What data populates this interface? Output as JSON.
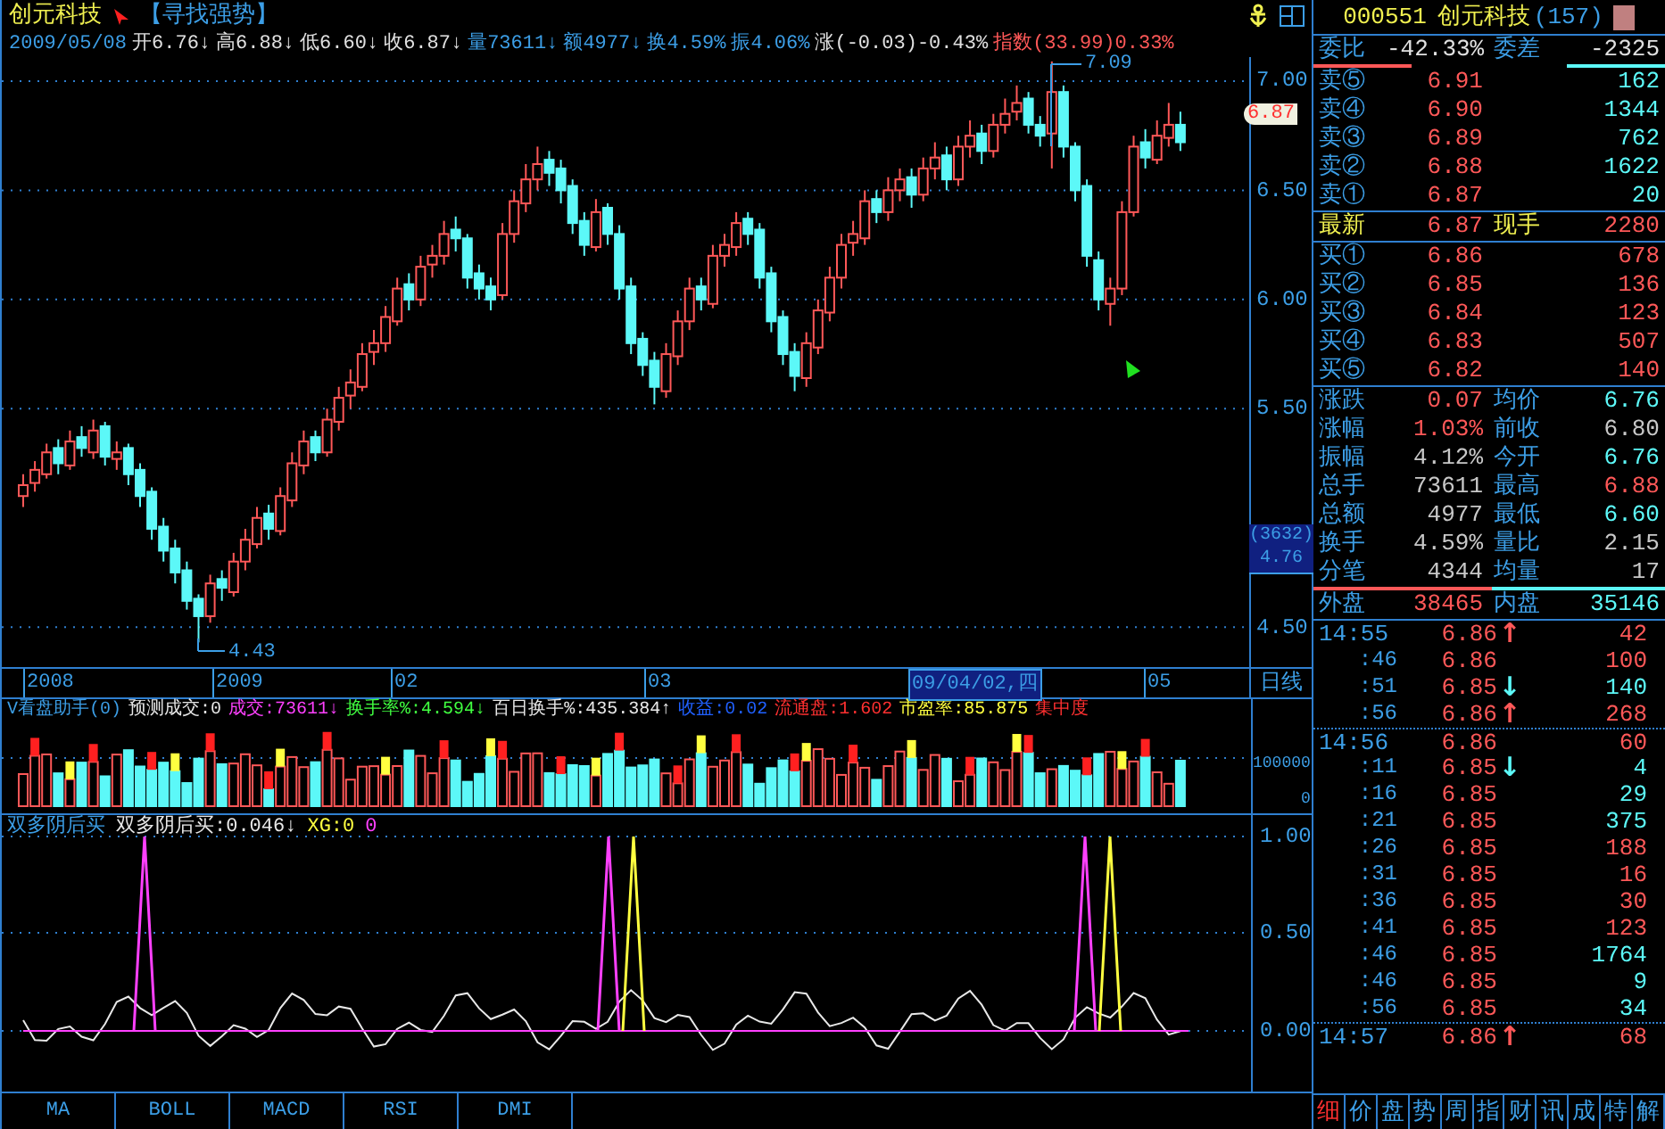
{
  "header": {
    "title": "创元科技",
    "tag": "【寻找强势】"
  },
  "info_line": [
    {
      "text": "2009/05/08",
      "color": "#3c9ee6"
    },
    {
      "text": "开6.76↓",
      "color": "#e0e0e0"
    },
    {
      "text": "高6.88↓",
      "color": "#e0e0e0"
    },
    {
      "text": "低6.60↓",
      "color": "#e0e0e0"
    },
    {
      "text": "收6.87↓",
      "color": "#e0e0e0"
    },
    {
      "text": "量73611↓",
      "color": "#3c9ee6"
    },
    {
      "text": "额4977↓",
      "color": "#3c9ee6"
    },
    {
      "text": "换4.59%",
      "color": "#3c9ee6"
    },
    {
      "text": "振4.06%",
      "color": "#3c9ee6"
    },
    {
      "text": "涨(-0.03)-0.43%",
      "color": "#e0e0e0"
    },
    {
      "text": "指数(33.99)0.33%",
      "color": "#ff5858"
    }
  ],
  "price_chart": {
    "high_label": "7.09",
    "low_label": "4.43",
    "last_price_tag": "6.87",
    "scale_box": {
      "count": "(3632)",
      "value": "4.76"
    },
    "chart_data": {
      "type": "candlestick",
      "ylim": [
        4.17,
        7.11
      ],
      "grid": true,
      "yticks": [
        {
          "value": 7,
          "label": "7.00"
        },
        {
          "value": 6.5,
          "label": "6.50"
        },
        {
          "value": 6,
          "label": "6.00"
        },
        {
          "value": 5.5,
          "label": "5.50"
        },
        {
          "value": 4.5,
          "label": "4.50"
        }
      ],
      "ohlc": [
        [
          5.1,
          5.2,
          5.05,
          5.15
        ],
        [
          5.16,
          5.26,
          5.12,
          5.22
        ],
        [
          5.2,
          5.34,
          5.18,
          5.3
        ],
        [
          5.32,
          5.36,
          5.2,
          5.25
        ],
        [
          5.24,
          5.4,
          5.22,
          5.35
        ],
        [
          5.37,
          5.42,
          5.28,
          5.32
        ],
        [
          5.3,
          5.45,
          5.27,
          5.4
        ],
        [
          5.42,
          5.44,
          5.24,
          5.28
        ],
        [
          5.27,
          5.35,
          5.22,
          5.3
        ],
        [
          5.32,
          5.34,
          5.15,
          5.2
        ],
        [
          5.22,
          5.25,
          5.05,
          5.1
        ],
        [
          5.12,
          5.14,
          4.9,
          4.95
        ],
        [
          4.96,
          5.0,
          4.8,
          4.85
        ],
        [
          4.86,
          4.9,
          4.7,
          4.75
        ],
        [
          4.76,
          4.8,
          4.58,
          4.62
        ],
        [
          4.63,
          4.65,
          4.43,
          4.55
        ],
        [
          4.55,
          4.74,
          4.52,
          4.7
        ],
        [
          4.72,
          4.76,
          4.62,
          4.68
        ],
        [
          4.66,
          4.84,
          4.64,
          4.8
        ],
        [
          4.8,
          4.95,
          4.76,
          4.9
        ],
        [
          4.88,
          5.05,
          4.86,
          5.0
        ],
        [
          5.02,
          5.06,
          4.9,
          4.95
        ],
        [
          4.94,
          5.14,
          4.92,
          5.1
        ],
        [
          5.08,
          5.3,
          5.05,
          5.25
        ],
        [
          5.24,
          5.4,
          5.2,
          5.35
        ],
        [
          5.37,
          5.4,
          5.26,
          5.3
        ],
        [
          5.3,
          5.5,
          5.28,
          5.45
        ],
        [
          5.44,
          5.6,
          5.4,
          5.55
        ],
        [
          5.56,
          5.68,
          5.5,
          5.62
        ],
        [
          5.6,
          5.8,
          5.58,
          5.75
        ],
        [
          5.76,
          5.86,
          5.7,
          5.8
        ],
        [
          5.8,
          5.97,
          5.76,
          5.92
        ],
        [
          5.9,
          6.1,
          5.88,
          6.05
        ],
        [
          6.07,
          6.12,
          5.95,
          6.0
        ],
        [
          6.0,
          6.2,
          5.97,
          6.15
        ],
        [
          6.16,
          6.25,
          6.1,
          6.2
        ],
        [
          6.2,
          6.36,
          6.16,
          6.3
        ],
        [
          6.32,
          6.38,
          6.22,
          6.28
        ],
        [
          6.28,
          6.3,
          6.05,
          6.1
        ],
        [
          6.12,
          6.16,
          6.0,
          6.05
        ],
        [
          6.06,
          6.1,
          5.95,
          6.0
        ],
        [
          6.02,
          6.35,
          6.0,
          6.3
        ],
        [
          6.3,
          6.5,
          6.26,
          6.45
        ],
        [
          6.44,
          6.62,
          6.4,
          6.55
        ],
        [
          6.55,
          6.7,
          6.5,
          6.62
        ],
        [
          6.64,
          6.68,
          6.52,
          6.58
        ],
        [
          6.6,
          6.64,
          6.44,
          6.5
        ],
        [
          6.52,
          6.55,
          6.3,
          6.35
        ],
        [
          6.36,
          6.4,
          6.2,
          6.25
        ],
        [
          6.24,
          6.46,
          6.22,
          6.4
        ],
        [
          6.42,
          6.44,
          6.25,
          6.3
        ],
        [
          6.3,
          6.34,
          6.0,
          6.05
        ],
        [
          6.06,
          6.1,
          5.75,
          5.8
        ],
        [
          5.82,
          5.85,
          5.65,
          5.7
        ],
        [
          5.72,
          5.76,
          5.52,
          5.6
        ],
        [
          5.58,
          5.8,
          5.55,
          5.75
        ],
        [
          5.74,
          5.95,
          5.7,
          5.9
        ],
        [
          5.9,
          6.1,
          5.86,
          6.05
        ],
        [
          6.06,
          6.1,
          5.95,
          6.0
        ],
        [
          5.98,
          6.25,
          5.96,
          6.2
        ],
        [
          6.2,
          6.3,
          6.15,
          6.25
        ],
        [
          6.24,
          6.4,
          6.2,
          6.35
        ],
        [
          6.37,
          6.4,
          6.25,
          6.3
        ],
        [
          6.32,
          6.35,
          6.05,
          6.1
        ],
        [
          6.12,
          6.15,
          5.85,
          5.9
        ],
        [
          5.92,
          5.95,
          5.7,
          5.75
        ],
        [
          5.76,
          5.8,
          5.58,
          5.65
        ],
        [
          5.64,
          5.85,
          5.6,
          5.8
        ],
        [
          5.78,
          6.0,
          5.75,
          5.95
        ],
        [
          5.94,
          6.15,
          5.9,
          6.1
        ],
        [
          6.1,
          6.3,
          6.05,
          6.25
        ],
        [
          6.26,
          6.36,
          6.2,
          6.3
        ],
        [
          6.28,
          6.5,
          6.25,
          6.45
        ],
        [
          6.46,
          6.5,
          6.35,
          6.4
        ],
        [
          6.4,
          6.56,
          6.36,
          6.5
        ],
        [
          6.5,
          6.6,
          6.45,
          6.55
        ],
        [
          6.56,
          6.6,
          6.42,
          6.48
        ],
        [
          6.48,
          6.65,
          6.45,
          6.6
        ],
        [
          6.6,
          6.72,
          6.55,
          6.65
        ],
        [
          6.66,
          6.7,
          6.5,
          6.55
        ],
        [
          6.55,
          6.75,
          6.52,
          6.7
        ],
        [
          6.7,
          6.82,
          6.65,
          6.75
        ],
        [
          6.76,
          6.8,
          6.62,
          6.68
        ],
        [
          6.68,
          6.85,
          6.65,
          6.8
        ],
        [
          6.8,
          6.92,
          6.76,
          6.85
        ],
        [
          6.86,
          6.98,
          6.82,
          6.9
        ],
        [
          6.92,
          6.95,
          6.76,
          6.8
        ],
        [
          6.8,
          6.84,
          6.7,
          6.75
        ],
        [
          6.76,
          7.09,
          6.6,
          6.95
        ],
        [
          6.95,
          6.98,
          6.65,
          6.7
        ],
        [
          6.7,
          6.72,
          6.45,
          6.5
        ],
        [
          6.52,
          6.55,
          6.15,
          6.2
        ],
        [
          6.18,
          6.22,
          5.95,
          6.0
        ],
        [
          5.98,
          6.1,
          5.88,
          6.05
        ],
        [
          6.05,
          6.45,
          6.02,
          6.4
        ],
        [
          6.4,
          6.75,
          6.38,
          6.7
        ],
        [
          6.72,
          6.78,
          6.6,
          6.65
        ],
        [
          6.64,
          6.82,
          6.62,
          6.75
        ],
        [
          6.74,
          6.9,
          6.7,
          6.8
        ],
        [
          6.8,
          6.86,
          6.68,
          6.72
        ]
      ]
    }
  },
  "date_axis": {
    "labels": [
      {
        "text": "2008",
        "selected": false
      },
      {
        "text": "2009",
        "selected": false
      },
      {
        "text": "02",
        "selected": false
      },
      {
        "text": "03",
        "selected": false
      },
      {
        "text": "09/04/02,四",
        "selected": true
      },
      {
        "text": "05",
        "selected": false
      }
    ],
    "period": "日线"
  },
  "volume_panel": {
    "legend": [
      {
        "text": "V看盘助手(0)",
        "color": "#3c9ee6"
      },
      {
        "text": "预测成交:0",
        "color": "#e8e8e8"
      },
      {
        "text": "成交:73611↓",
        "color": "#ff40ff"
      },
      {
        "text": "换手率%:4.594↓",
        "color": "#40ff40"
      },
      {
        "text": "百日换手%:435.384↑",
        "color": "#e8e8e8"
      },
      {
        "text": "收益:0.02",
        "color": "#2060ff"
      },
      {
        "text": "流通盘:1.602",
        "color": "#ff3030"
      },
      {
        "text": "市盈率:85.875",
        "color": "#ffff40"
      },
      {
        "text": "集中度",
        "color": "#ff3030"
      }
    ],
    "axis_ticks": [
      "100000",
      "0"
    ]
  },
  "indicator_panel": {
    "legend": [
      {
        "text": "双多阴后买",
        "color": "#3c9ee6"
      },
      {
        "text": "双多阴后买:0.046↓",
        "color": "#e8e8e8"
      },
      {
        "text": "XG:0",
        "color": "#ffff40"
      },
      {
        "text": "0",
        "color": "#ff40ff"
      }
    ],
    "axis_ticks": [
      "1.00",
      "0.50",
      "0.00"
    ]
  },
  "indicator_tabs": [
    "MA",
    "BOLL",
    "MACD",
    "RSI",
    "DMI"
  ],
  "quote": {
    "code": "000551",
    "name": "创元科技",
    "count": "(157)",
    "ratio": {
      "label": "委比",
      "value": "-42.33%",
      "label2": "委差",
      "value2": "-2325"
    },
    "sell": [
      {
        "label": "卖⑤",
        "price": "6.91",
        "volume": "162"
      },
      {
        "label": "卖④",
        "price": "6.90",
        "volume": "1344"
      },
      {
        "label": "卖③",
        "price": "6.89",
        "volume": "762"
      },
      {
        "label": "卖②",
        "price": "6.88",
        "volume": "1622"
      },
      {
        "label": "卖①",
        "price": "6.87",
        "volume": "20"
      }
    ],
    "latest": {
      "label": "最新",
      "value": "6.87",
      "label2": "现手",
      "value2": "2280"
    },
    "buy": [
      {
        "label": "买①",
        "price": "6.86",
        "volume": "678"
      },
      {
        "label": "买②",
        "price": "6.85",
        "volume": "136"
      },
      {
        "label": "买③",
        "price": "6.84",
        "volume": "123"
      },
      {
        "label": "买④",
        "price": "6.83",
        "volume": "507"
      },
      {
        "label": "买⑤",
        "price": "6.82",
        "volume": "140"
      }
    ],
    "stats": [
      {
        "left": {
          "label": "涨跌",
          "value": "0.07",
          "color": "#ff5858"
        },
        "right": {
          "label": "均价",
          "value": "6.76",
          "color": "#5cf8f8"
        }
      },
      {
        "left": {
          "label": "涨幅",
          "value": "1.03%",
          "color": "#ff5858"
        },
        "right": {
          "label": "前收",
          "value": "6.80",
          "color": "#c8c8c8"
        }
      },
      {
        "left": {
          "label": "振幅",
          "value": "4.12%",
          "color": "#c8c8c8"
        },
        "right": {
          "label": "今开",
          "value": "6.76",
          "color": "#5cf8f8"
        }
      },
      {
        "left": {
          "label": "总手",
          "value": "73611",
          "color": "#c8c8c8"
        },
        "right": {
          "label": "最高",
          "value": "6.88",
          "color": "#ff5858"
        }
      },
      {
        "left": {
          "label": "总额",
          "value": "4977",
          "color": "#c8c8c8"
        },
        "right": {
          "label": "最低",
          "value": "6.60",
          "color": "#5cf8f8"
        }
      },
      {
        "left": {
          "label": "换手",
          "value": "4.59%",
          "color": "#c8c8c8"
        },
        "right": {
          "label": "量比",
          "value": "2.15",
          "color": "#c8c8c8"
        }
      },
      {
        "left": {
          "label": "分笔",
          "value": "4344",
          "color": "#c8c8c8"
        },
        "right": {
          "label": "均量",
          "value": "17",
          "color": "#c8c8c8"
        }
      }
    ],
    "outer_inner": {
      "label": "外盘",
      "value": "38465",
      "label2": "内盘",
      "value2": "35146"
    }
  },
  "ticks": [
    {
      "kind": "minute",
      "time": "14:55",
      "price": "6.86",
      "arrow": {
        "text": "↑",
        "color": "#ff5858"
      },
      "volume": "42",
      "color": "#ff5858"
    },
    {
      "kind": "second",
      "time": ":46",
      "price": "6.86",
      "volume": "100",
      "color": "#ff5858"
    },
    {
      "kind": "second",
      "time": ":51",
      "price": "6.85",
      "arrow": {
        "text": "↓",
        "color": "#5cf8f8"
      },
      "volume": "140",
      "color": "#5cf8f8"
    },
    {
      "kind": "second",
      "time": ":56",
      "price": "6.86",
      "arrow": {
        "text": "↑",
        "color": "#ff5858"
      },
      "volume": "268",
      "color": "#ff5858"
    },
    {
      "kind": "minute",
      "time": "14:56",
      "price": "6.86",
      "volume": "60",
      "color": "#ff5858"
    },
    {
      "kind": "second",
      "time": ":11",
      "price": "6.85",
      "arrow": {
        "text": "↓",
        "color": "#5cf8f8"
      },
      "volume": "4",
      "color": "#5cf8f8"
    },
    {
      "kind": "second",
      "time": ":16",
      "price": "6.85",
      "volume": "29",
      "color": "#5cf8f8"
    },
    {
      "kind": "second",
      "time": ":21",
      "price": "6.85",
      "volume": "375",
      "color": "#5cf8f8"
    },
    {
      "kind": "second",
      "time": ":26",
      "price": "6.85",
      "volume": "188",
      "color": "#ff5858"
    },
    {
      "kind": "second",
      "time": ":31",
      "price": "6.85",
      "volume": "16",
      "color": "#ff5858"
    },
    {
      "kind": "second",
      "time": ":36",
      "price": "6.85",
      "volume": "30",
      "color": "#ff5858"
    },
    {
      "kind": "second",
      "time": ":41",
      "price": "6.85",
      "volume": "123",
      "color": "#ff5858"
    },
    {
      "kind": "second",
      "time": ":46",
      "price": "6.85",
      "volume": "1764",
      "color": "#5cf8f8"
    },
    {
      "kind": "second",
      "time": ":46",
      "price": "6.85",
      "volume": "9",
      "color": "#5cf8f8"
    },
    {
      "kind": "second",
      "time": ":56",
      "price": "6.85",
      "volume": "34",
      "color": "#5cf8f8"
    },
    {
      "kind": "minute",
      "time": "14:57",
      "price": "6.86",
      "arrow": {
        "text": "↑",
        "color": "#ff5858"
      },
      "volume": "68",
      "color": "#ff5858"
    }
  ],
  "quote_tabs": [
    {
      "label": "细",
      "selected": true
    },
    {
      "label": "价",
      "selected": false
    },
    {
      "label": "盘",
      "selected": false
    },
    {
      "label": "势",
      "selected": false
    },
    {
      "label": "周",
      "selected": false
    },
    {
      "label": "指",
      "selected": false
    },
    {
      "label": "财",
      "selected": false
    },
    {
      "label": "讯",
      "selected": false
    },
    {
      "label": "成",
      "selected": false
    },
    {
      "label": "特",
      "selected": false
    },
    {
      "label": "解",
      "selected": false
    }
  ]
}
